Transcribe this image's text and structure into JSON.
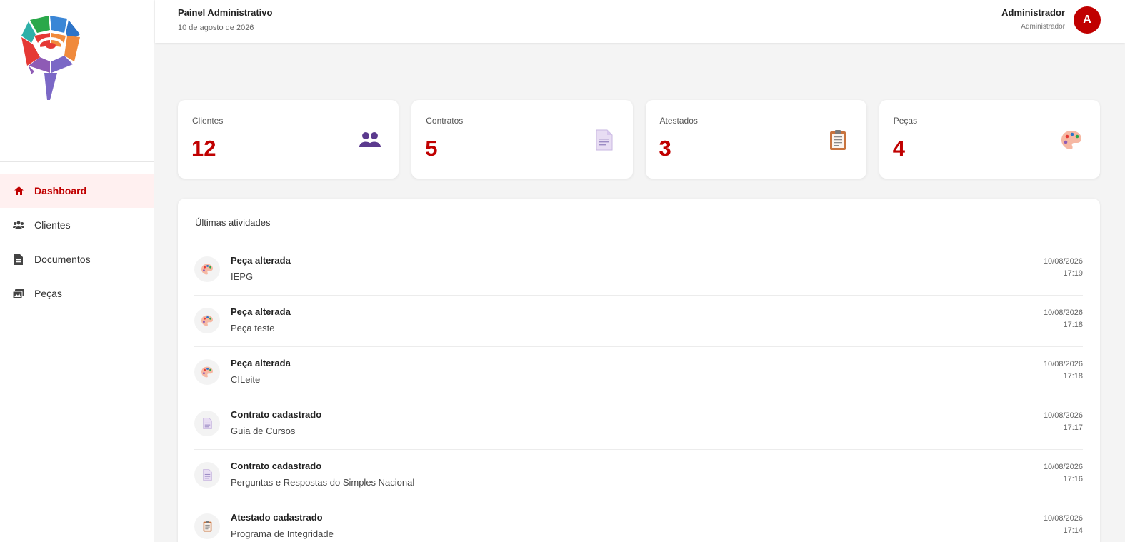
{
  "header": {
    "title": "Painel Administrativo",
    "date": "10 de agosto de 2026",
    "user_name": "Administrador",
    "user_role": "Administrador",
    "avatar_initial": "A"
  },
  "sidebar": {
    "items": [
      {
        "label": "Dashboard",
        "icon": "home-icon",
        "active": true
      },
      {
        "label": "Clientes",
        "icon": "users-icon",
        "active": false
      },
      {
        "label": "Documentos",
        "icon": "file-icon",
        "active": false
      },
      {
        "label": "Peças",
        "icon": "images-icon",
        "active": false
      }
    ]
  },
  "stats": [
    {
      "label": "Clientes",
      "value": "12",
      "icon": "people-icon"
    },
    {
      "label": "Contratos",
      "value": "5",
      "icon": "document-icon"
    },
    {
      "label": "Atestados",
      "value": "3",
      "icon": "clipboard-icon"
    },
    {
      "label": "Peças",
      "value": "4",
      "icon": "palette-icon"
    }
  ],
  "activities": {
    "title": "Últimas atividades",
    "items": [
      {
        "head": "Peça alterada",
        "sub": "IEPG",
        "date": "10/08/2026",
        "time": "17:19",
        "icon": "palette-icon"
      },
      {
        "head": "Peça alterada",
        "sub": "Peça teste",
        "date": "10/08/2026",
        "time": "17:18",
        "icon": "palette-icon"
      },
      {
        "head": "Peça alterada",
        "sub": "CILeite",
        "date": "10/08/2026",
        "time": "17:18",
        "icon": "palette-icon"
      },
      {
        "head": "Contrato cadastrado",
        "sub": "Guia de Cursos",
        "date": "10/08/2026",
        "time": "17:17",
        "icon": "document-icon"
      },
      {
        "head": "Contrato cadastrado",
        "sub": "Perguntas e Respostas do Simples Nacional",
        "date": "10/08/2026",
        "time": "17:16",
        "icon": "document-icon"
      },
      {
        "head": "Atestado cadastrado",
        "sub": "Programa de Integridade",
        "date": "10/08/2026",
        "time": "17:14",
        "icon": "clipboard-icon"
      }
    ]
  },
  "colors": {
    "accent": "#c00000",
    "active_bg": "#fff0f0"
  }
}
